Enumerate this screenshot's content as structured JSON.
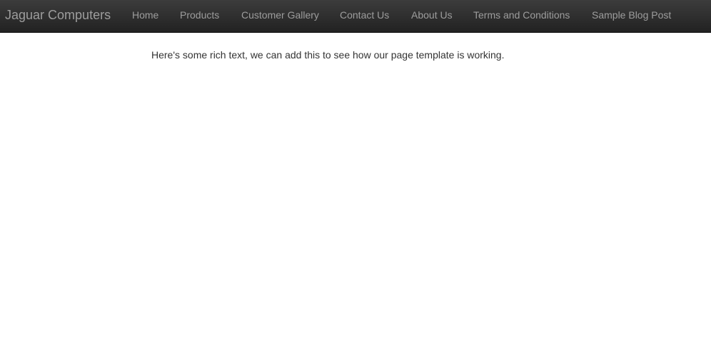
{
  "navbar": {
    "brand": "Jaguar Computers",
    "links": [
      {
        "label": "Home"
      },
      {
        "label": "Products"
      },
      {
        "label": "Customer Gallery"
      },
      {
        "label": "Contact Us"
      },
      {
        "label": "About Us"
      },
      {
        "label": "Terms and Conditions"
      },
      {
        "label": "Sample Blog Post"
      }
    ],
    "colors": {
      "background": "#222222",
      "text": "#9d9d9d"
    }
  },
  "main": {
    "rich_text": "Here's some rich text, we can add this to see how our page template is working."
  }
}
